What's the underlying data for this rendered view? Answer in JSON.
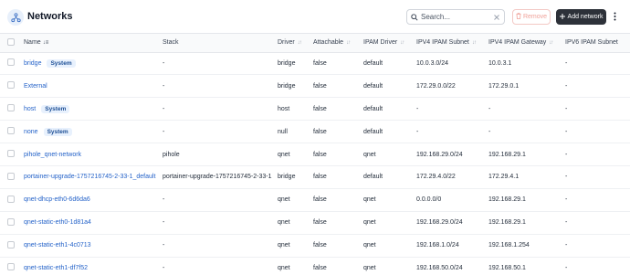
{
  "header": {
    "title": "Networks",
    "icon": "network-icon"
  },
  "toolbar": {
    "search_placeholder": "Search...",
    "remove_label": "Remove",
    "add_label": "Add network"
  },
  "columns": [
    "Name",
    "Stack",
    "Driver",
    "Attachable",
    "IPAM Driver",
    "IPV4 IPAM Subnet",
    "IPV4 IPAM Gateway",
    "IPV6 IPAM Subnet"
  ],
  "rows": [
    {
      "name": "bridge",
      "badge": "System",
      "stack": "-",
      "driver": "bridge",
      "attachable": "false",
      "ipam_driver": "default",
      "ipv4_subnet": "10.0.3.0/24",
      "ipv4_gateway": "10.0.3.1",
      "ipv6_subnet": "-"
    },
    {
      "name": "External",
      "badge": "",
      "stack": "-",
      "driver": "bridge",
      "attachable": "false",
      "ipam_driver": "default",
      "ipv4_subnet": "172.29.0.0/22",
      "ipv4_gateway": "172.29.0.1",
      "ipv6_subnet": "-"
    },
    {
      "name": "host",
      "badge": "System",
      "stack": "-",
      "driver": "host",
      "attachable": "false",
      "ipam_driver": "default",
      "ipv4_subnet": "-",
      "ipv4_gateway": "-",
      "ipv6_subnet": "-"
    },
    {
      "name": "none",
      "badge": "System",
      "stack": "-",
      "driver": "null",
      "attachable": "false",
      "ipam_driver": "default",
      "ipv4_subnet": "-",
      "ipv4_gateway": "-",
      "ipv6_subnet": "-"
    },
    {
      "name": "pihole_qnet-network",
      "badge": "",
      "stack": "pihole",
      "driver": "qnet",
      "attachable": "false",
      "ipam_driver": "qnet",
      "ipv4_subnet": "192.168.29.0/24",
      "ipv4_gateway": "192.168.29.1",
      "ipv6_subnet": "-"
    },
    {
      "name": "portainer-upgrade-1757216745-2-33-1_default",
      "badge": "",
      "stack": "portainer-upgrade-1757216745-2-33-1",
      "driver": "bridge",
      "attachable": "false",
      "ipam_driver": "default",
      "ipv4_subnet": "172.29.4.0/22",
      "ipv4_gateway": "172.29.4.1",
      "ipv6_subnet": "-"
    },
    {
      "name": "qnet-dhcp-eth0-6d6da6",
      "badge": "",
      "stack": "-",
      "driver": "qnet",
      "attachable": "false",
      "ipam_driver": "qnet",
      "ipv4_subnet": "0.0.0.0/0",
      "ipv4_gateway": "192.168.29.1",
      "ipv6_subnet": "-"
    },
    {
      "name": "qnet-static-eth0-1d81a4",
      "badge": "",
      "stack": "-",
      "driver": "qnet",
      "attachable": "false",
      "ipam_driver": "qnet",
      "ipv4_subnet": "192.168.29.0/24",
      "ipv4_gateway": "192.168.29.1",
      "ipv6_subnet": "-"
    },
    {
      "name": "qnet-static-eth1-4c0713",
      "badge": "",
      "stack": "-",
      "driver": "qnet",
      "attachable": "false",
      "ipam_driver": "qnet",
      "ipv4_subnet": "192.168.1.0/24",
      "ipv4_gateway": "192.168.1.254",
      "ipv6_subnet": "-"
    },
    {
      "name": "qnet-static-eth1-df7f52",
      "badge": "",
      "stack": "-",
      "driver": "qnet",
      "attachable": "false",
      "ipam_driver": "qnet",
      "ipv4_subnet": "192.168.50.0/24",
      "ipv4_gateway": "192.168.50.1",
      "ipv6_subnet": "-"
    }
  ],
  "colors": {
    "link": "#2563c9",
    "badge_bg": "#e8f1fd",
    "badge_text": "#1c4e95",
    "add_button_bg": "#2d3139",
    "remove_text": "#f0a29a"
  }
}
